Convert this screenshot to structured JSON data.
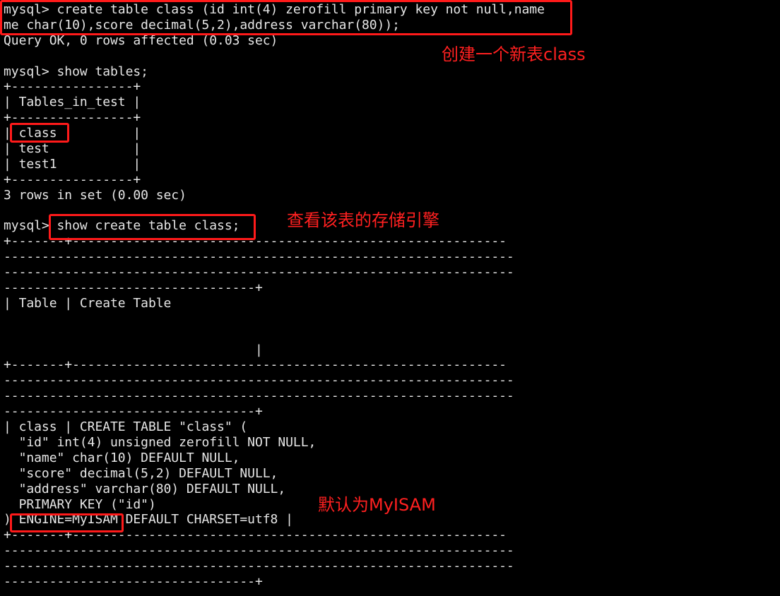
{
  "terminal": {
    "lines": [
      "mysql> create table class (id int(4) zerofill primary key not null,name",
      "me char(10),score decimal(5,2),address varchar(80));",
      "Query OK, 0 rows affected (0.03 sec)",
      "",
      "mysql> show tables;",
      "+----------------+",
      "| Tables_in_test |",
      "+----------------+",
      "| class          |",
      "| test           |",
      "| test1          |",
      "+----------------+",
      "3 rows in set (0.00 sec)",
      "",
      "mysql> show create table class;",
      "+-------+---------------------------------------------------------",
      "-------------------------------------------------------------------",
      "-------------------------------------------------------------------",
      "---------------------------------+",
      "| Table | Create Table",
      "",
      "",
      "                                 |",
      "+-------+---------------------------------------------------------",
      "-------------------------------------------------------------------",
      "-------------------------------------------------------------------",
      "---------------------------------+",
      "| class | CREATE TABLE \"class\" (",
      "  \"id\" int(4) unsigned zerofill NOT NULL,",
      "  \"name\" char(10) DEFAULT NULL,",
      "  \"score\" decimal(5,2) DEFAULT NULL,",
      "  \"address\" varchar(80) DEFAULT NULL,",
      "  PRIMARY KEY (\"id\")",
      ") ENGINE=MyISAM DEFAULT CHARSET=utf8 |",
      "+-------+---------------------------------------------------------",
      "-------------------------------------------------------------------",
      "-------------------------------------------------------------------",
      "---------------------------------+"
    ]
  },
  "annotations": {
    "create_table": "创建一个新表class",
    "show_engine": "查看该表的存储引擎",
    "default_engine": "默认为MyISAM"
  },
  "colors": {
    "background": "#000000",
    "text": "#e6e6e6",
    "annotation": "#ff2020"
  }
}
